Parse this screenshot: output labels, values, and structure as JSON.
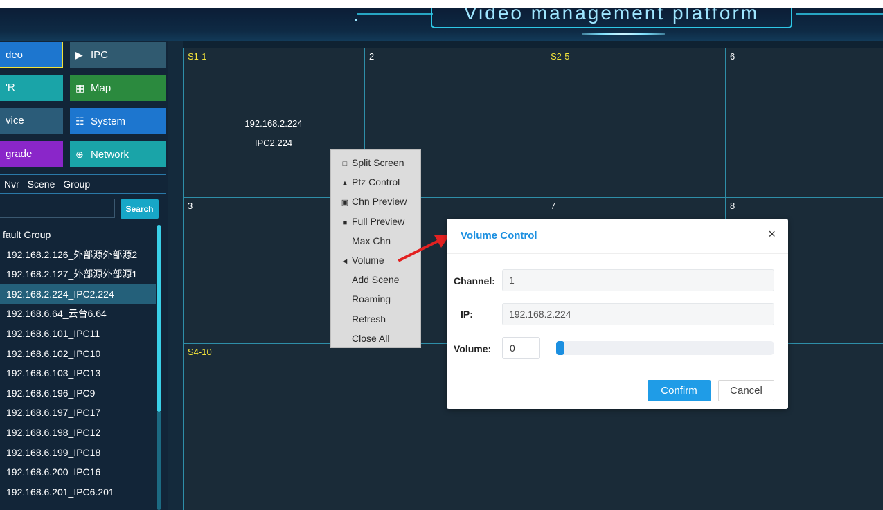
{
  "header": {
    "title": "Video management platform"
  },
  "nav": [
    {
      "label": "deo",
      "icon": "video-icon",
      "glyph": "",
      "bg": "#1d76cf"
    },
    {
      "label": "IPC",
      "icon": "camera-icon",
      "glyph": "▶",
      "bg": "#305a70"
    },
    {
      "label": "'R",
      "icon": "nvr-icon",
      "glyph": "",
      "bg": "#1aa4a8"
    },
    {
      "label": "Map",
      "icon": "map-icon",
      "glyph": "▦",
      "bg": "#2b8a3e"
    },
    {
      "label": "vice",
      "icon": "device-icon",
      "glyph": "",
      "bg": "#2b5c79"
    },
    {
      "label": "System",
      "icon": "grid-icon",
      "glyph": "☷",
      "bg": "#1d76cf"
    },
    {
      "label": "grade",
      "icon": "upgrade-icon",
      "glyph": "",
      "bg": "#8a26c9"
    },
    {
      "label": "Network",
      "icon": "globe-icon",
      "glyph": "⊕",
      "bg": "#1aa4a8"
    }
  ],
  "tabs": [
    "Nvr",
    "Scene",
    "Group"
  ],
  "search": {
    "button": "Search",
    "value": ""
  },
  "tree": {
    "group": "fault Group",
    "items": [
      "192.168.2.126_外部源外部源2",
      "192.168.2.127_外部源外部源1",
      "192.168.2.224_IPC2.224",
      "192.168.6.64_云台6.64",
      "192.168.6.101_IPC11",
      "192.168.6.102_IPC10",
      "192.168.6.103_IPC13",
      "192.168.6.196_IPC9",
      "192.168.6.197_IPC17",
      "192.168.6.198_IPC12",
      "192.168.6.199_IPC18",
      "192.168.6.200_IPC16",
      "192.168.6.201_IPC6.201"
    ],
    "selected_index": 2
  },
  "grid": {
    "cells": [
      "S1-1",
      "2",
      "S2-5",
      "6",
      "3",
      "7",
      "8",
      "S4-10"
    ],
    "cell1_ip": "192.168.2.224",
    "cell1_name": "IPC2.224"
  },
  "context_menu": [
    {
      "label": "Split Screen",
      "icon": "window-icon",
      "glyph": "□"
    },
    {
      "label": "Ptz Control",
      "icon": "ptz-icon",
      "glyph": "▲"
    },
    {
      "label": "Chn Preview",
      "icon": "preview-icon",
      "glyph": "▣"
    },
    {
      "label": "Full Preview",
      "icon": "full-preview-icon",
      "glyph": "■"
    },
    {
      "label": "Max Chn",
      "icon": "",
      "glyph": ""
    },
    {
      "label": "Volume",
      "icon": "speaker-icon",
      "glyph": "◄"
    },
    {
      "label": "Add Scene",
      "icon": "",
      "glyph": ""
    },
    {
      "label": "Roaming",
      "icon": "",
      "glyph": ""
    },
    {
      "label": "Refresh",
      "icon": "",
      "glyph": ""
    },
    {
      "label": "Close All",
      "icon": "",
      "glyph": ""
    }
  ],
  "modal": {
    "title": "Volume Control",
    "close": "×",
    "channel_label": "Channel:",
    "channel_value": "1",
    "ip_label": "IP:",
    "ip_value": "192.168.2.224",
    "volume_label": "Volume:",
    "volume_value": "0",
    "volume_level": 0,
    "confirm": "Confirm",
    "cancel": "Cancel"
  }
}
